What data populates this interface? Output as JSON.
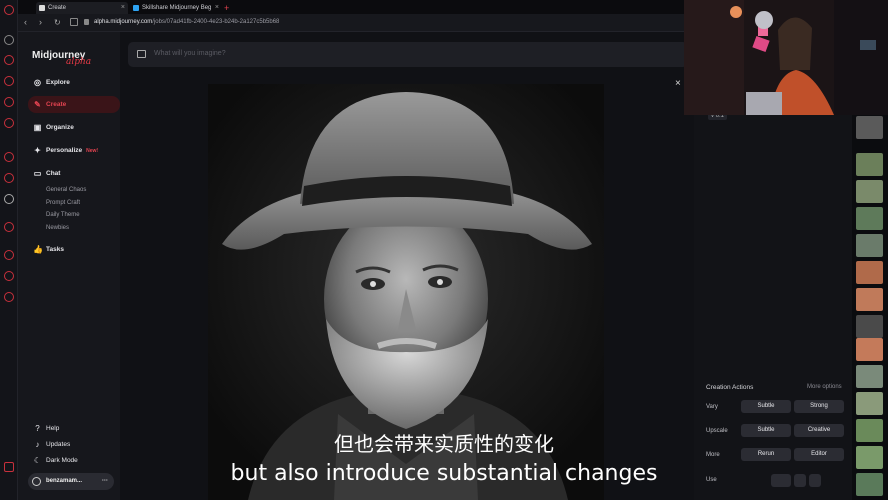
{
  "browser": {
    "tabs": [
      {
        "title": "Create",
        "active": true
      },
      {
        "title": "Skillshare Midjourney Beg",
        "active": false
      }
    ],
    "url_domain": "alpha.midjourney.com",
    "url_path": "/jobs/07ad41fb-2400-4e23-b24b-2a127c5b5b68"
  },
  "sidebar": {
    "logo_text": "Midjourney",
    "logo_sub": "alpha",
    "items": [
      {
        "label": "Explore",
        "icon": "compass-icon"
      },
      {
        "label": "Create",
        "icon": "brush-icon",
        "active": true
      },
      {
        "label": "Organize",
        "icon": "folder-icon"
      },
      {
        "label": "Personalize",
        "icon": "sparkle-icon",
        "badge": "New!"
      },
      {
        "label": "Chat",
        "icon": "chat-icon"
      },
      {
        "label": "Tasks",
        "icon": "thumbs-up-icon"
      }
    ],
    "chat_rooms": [
      "General Chaos",
      "Prompt Craft",
      "Daily Theme",
      "Newbies"
    ],
    "footer": [
      {
        "label": "Help",
        "icon": "help-icon"
      },
      {
        "label": "Updates",
        "icon": "bell-icon"
      },
      {
        "label": "Dark Mode",
        "icon": "moon-icon"
      }
    ],
    "username": "benzamam..."
  },
  "prompt": {
    "placeholder": "What will you imagine?"
  },
  "job": {
    "version": "v 6.1"
  },
  "creation_actions": {
    "title": "Creation Actions",
    "more": "More options",
    "rows": [
      {
        "label": "Vary",
        "buttons": [
          "Subtle",
          "Strong"
        ]
      },
      {
        "label": "Upscale",
        "buttons": [
          "Subtle",
          "Creative"
        ]
      },
      {
        "label": "More",
        "buttons": [
          "Rerun",
          "Editor"
        ]
      },
      {
        "label": "Use",
        "buttons": [
          "",
          "",
          ""
        ]
      }
    ]
  },
  "subtitles": {
    "cn": "但也会带来实质性的变化",
    "en": "but also introduce substantial changes"
  }
}
